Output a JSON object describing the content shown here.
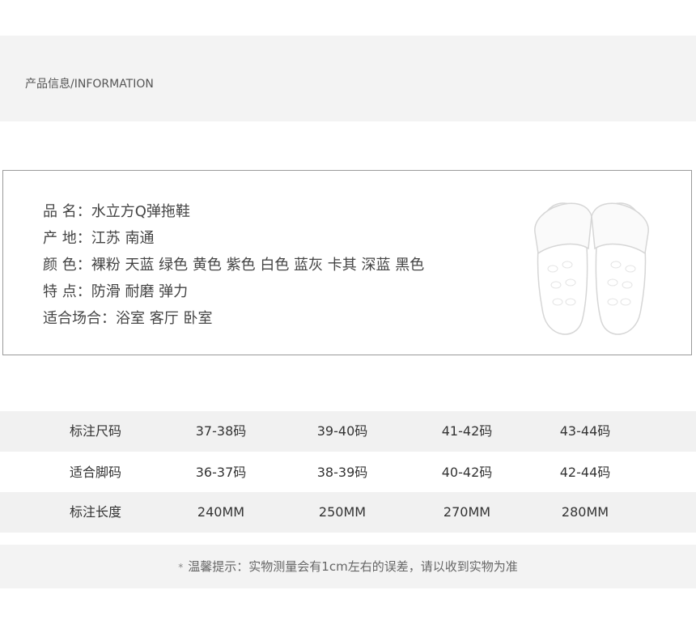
{
  "header": {
    "title": "产品信息/INFORMATION"
  },
  "product": {
    "lines": [
      "品  名：水立方Q弹拖鞋",
      "产  地：江苏 南通",
      "颜  色：裸粉 天蓝  绿色  黄色 紫色 白色 蓝灰 卡其 深蓝 黑色",
      "特  点：防滑 耐磨 弹力",
      "适合场合：浴室 客厅 卧室"
    ]
  },
  "size_table": {
    "rows": [
      {
        "label": "标注尺码",
        "values": [
          "37-38码",
          "39-40码",
          "41-42码",
          "43-44码"
        ]
      },
      {
        "label": "适合脚码",
        "values": [
          "36-37码",
          "38-39码",
          "40-42码",
          "42-44码"
        ]
      },
      {
        "label": "标注长度",
        "values": [
          "240MM",
          "250MM",
          "270MM",
          "280MM"
        ]
      }
    ]
  },
  "footer": {
    "star": "*",
    "note": "温馨提示：实物测量会有1cm左右的误差，请以收到实物为准"
  }
}
